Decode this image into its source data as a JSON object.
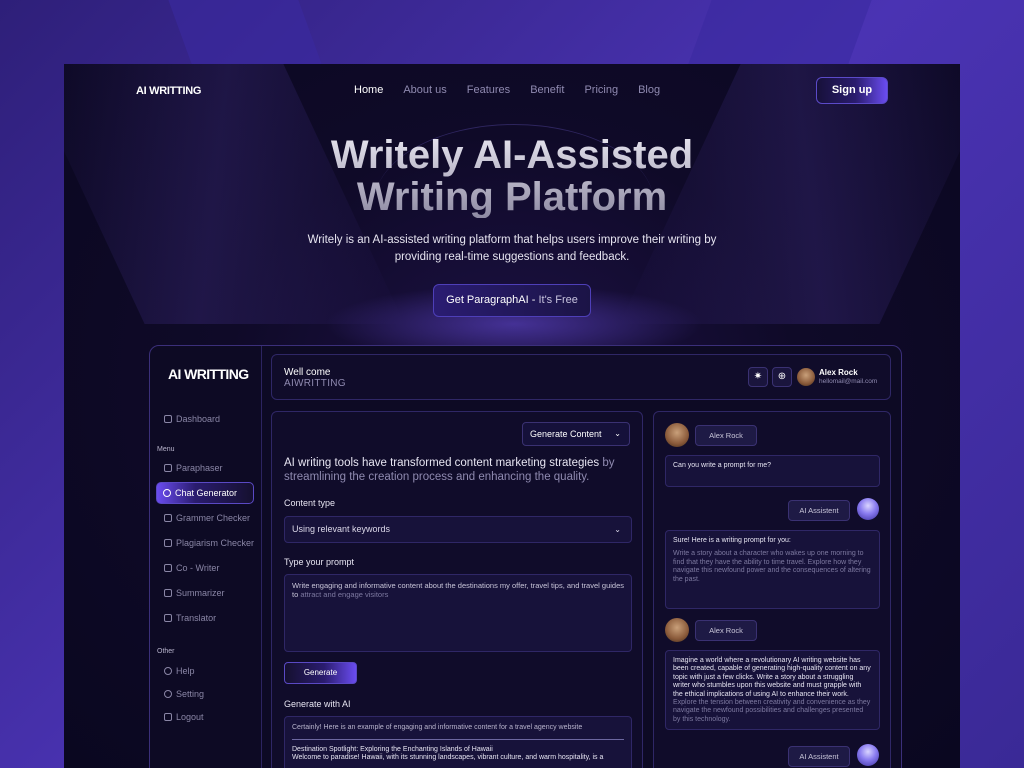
{
  "nav": {
    "logo": "AI WRITTING",
    "links": [
      "Home",
      "About us",
      "Features",
      "Benefit",
      "Pricing",
      "Blog"
    ],
    "signup": "Sign up"
  },
  "hero": {
    "title_line1": "Writely AI-Assisted",
    "title_line2": "Writing Platform",
    "subtitle": "Writely is an AI-assisted writing platform that helps users improve their writing by providing real-time suggestions and feedback.",
    "cta_main": "Get ParagraphAI - ",
    "cta_light": "It's Free"
  },
  "app": {
    "logo": "AI WRITTING",
    "sidebar": {
      "dashboard": "Dashboard",
      "menu_heading": "Menu",
      "menu_items": [
        "Paraphaser",
        "Chat Generator",
        "Grammer Checker",
        "Plagiarism Checker",
        "Co - Writer",
        "Summarizer",
        "Translator"
      ],
      "active_item": "Chat Generator",
      "other_heading": "Other",
      "other_items": [
        "Help",
        "Setting",
        "Logout"
      ]
    },
    "header": {
      "welcome": "Well come",
      "brand": "AIWRITTING",
      "user_name": "Alex Rock",
      "user_email": "hellomail@mail.com"
    },
    "main": {
      "dropdown": "Generate Content",
      "intro_bright": "AI writing tools have transformed content marketing strategies",
      "intro_dim": "by streamlining the creation process and enhancing the quality.",
      "content_type_label": "Content type",
      "content_type_value": "Using relevant keywords",
      "prompt_label": "Type your prompt",
      "prompt_bright": "Write engaging and informative content about the destinations my offer, travel tips, and travel guides to",
      "prompt_dim": "attract and engage visitors",
      "generate_button": "Generate",
      "generate_ai_label": "Generate with AI",
      "output_intro": "Certainly! Here is an example of engaging and informative content for a travel agency website",
      "output_title": "Destination Spotlight: Exploring the Enchanting Islands of Hawaii",
      "output_text": "Welcome to paradise! Hawaii, with its stunning landscapes, vibrant culture, and warm hospitality, is a"
    },
    "chat": {
      "user_name": "Alex Rock",
      "bot_name": "AI Assistent",
      "msg1": "Can you write a prompt for me?",
      "reply1_head": "Sure! Here is a writing prompt for you:",
      "reply1_body": "Write a story about a character who wakes up one morning to find that they have the ability to time travel. Explore how they navigate this newfound power and the consequences of altering the past.",
      "msg2_bright": "Imagine a world where a revolutionary AI writing website has been created, capable of generating high-quality content on any topic with just a few clicks. Write a story about a struggling writer who stumbles upon this website and must grapple with the ethical implications of using AI to enhance their work.",
      "msg2_dim": "Explore the tension between creativity and convenience as they navigate the newfound possibilities and challenges presented by this technology."
    }
  }
}
